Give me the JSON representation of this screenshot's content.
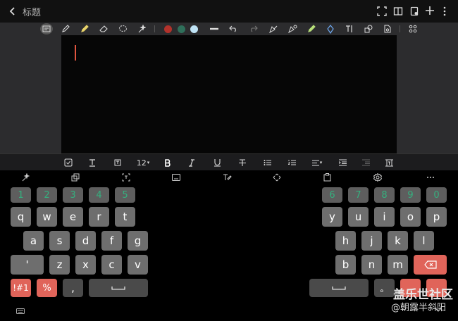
{
  "header": {
    "title": "标题"
  },
  "colors": {
    "pen_red": "#b3322b",
    "pen_green": "#2f6f5a",
    "pen_lightblue": "#bfe3f5",
    "accent_red": "#e0645a",
    "number_green": "#35b07f"
  },
  "format": {
    "font_size": "12"
  },
  "keyboard": {
    "left_numbers": [
      "1",
      "2",
      "3",
      "4",
      "5"
    ],
    "right_numbers": [
      "6",
      "7",
      "8",
      "9",
      "0"
    ],
    "left_row1": [
      "q",
      "w",
      "e",
      "r",
      "t"
    ],
    "right_row1": [
      "y",
      "u",
      "i",
      "o",
      "p"
    ],
    "left_row2": [
      "a",
      "s",
      "d",
      "f",
      "g"
    ],
    "right_row2": [
      "h",
      "j",
      "k",
      "l"
    ],
    "left_row3": [
      "'",
      "z",
      "x",
      "c",
      "v"
    ],
    "right_row3": [
      "b",
      "n",
      "m"
    ],
    "sym_label": "!#1",
    "percent_label": "%",
    "comma_label": ",",
    "period_label": "。"
  },
  "watermark": {
    "logo": "盖乐世社区",
    "user": "@朝露半斜阳"
  }
}
